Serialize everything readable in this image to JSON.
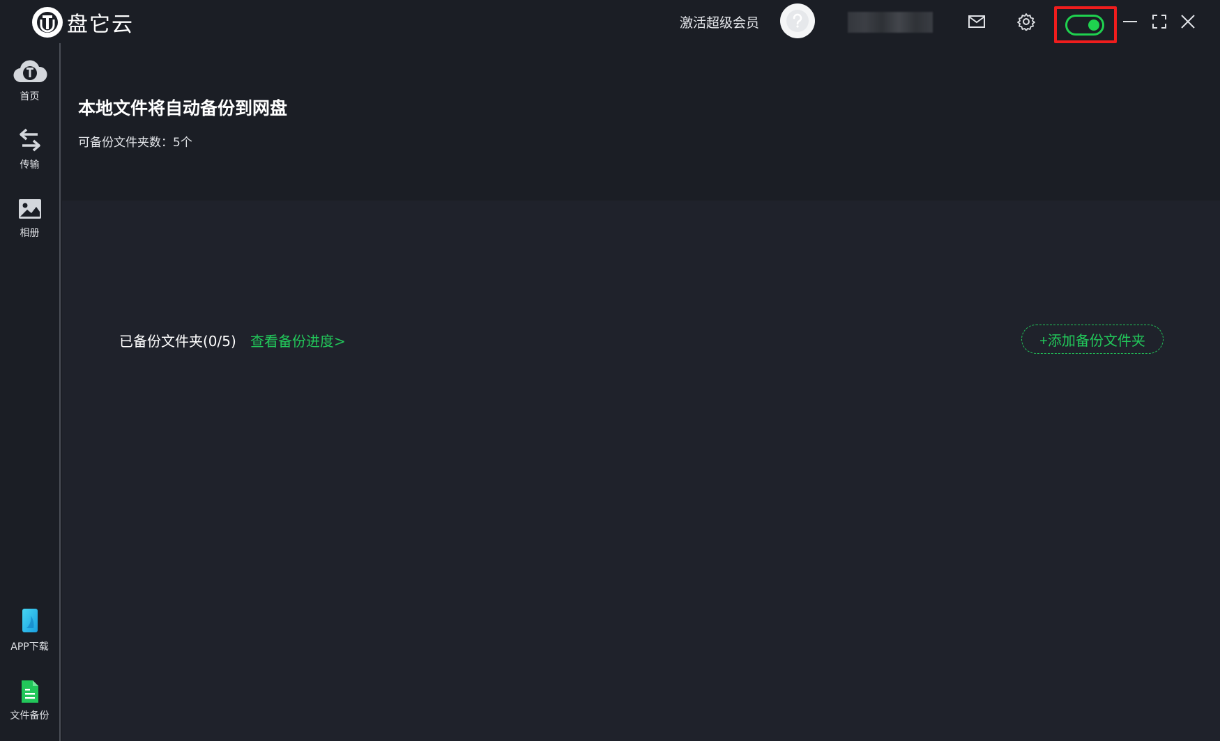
{
  "app": {
    "name": "盘它云"
  },
  "titlebar": {
    "vip_link": "激活超级会员"
  },
  "sidebar": {
    "items": [
      {
        "label": "首页",
        "icon": "cloud-logo-icon"
      },
      {
        "label": "传输",
        "icon": "transfer-arrows-icon"
      },
      {
        "label": "相册",
        "icon": "photo-icon"
      }
    ],
    "bottom_items": [
      {
        "label": "APP下载",
        "icon": "phone-icon"
      },
      {
        "label": "文件备份",
        "icon": "document-icon"
      }
    ]
  },
  "main": {
    "title": "本地文件将自动备份到网盘",
    "folder_count": "可备份文件夹数：5个",
    "backed_label": "已备份文件夹(0/5)",
    "progress_link": "查看备份进度>",
    "add_button": "+添加备份文件夹"
  },
  "colors": {
    "accent": "#22c75a",
    "background": "#1b1e25",
    "highlight": "#f01d1d"
  }
}
